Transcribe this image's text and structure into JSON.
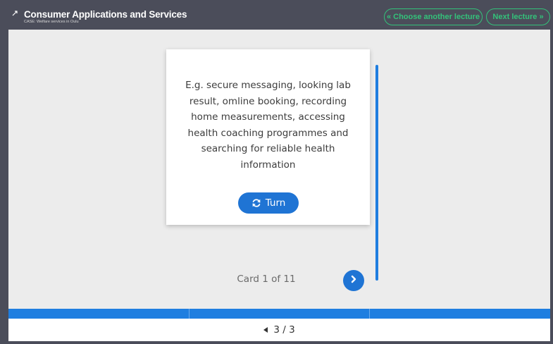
{
  "header": {
    "title": "Consumer Applications and Services",
    "subtitle": "CASE: Welfare services in Oulu",
    "choose_lecture_label": "« Choose another lecture",
    "next_lecture_label": "Next lecture »"
  },
  "card": {
    "text": "E.g. secure messaging, looking lab result, omline booking, recording home measurements, accessing health coaching programmes and searching for reliable health information",
    "turn_label": "Turn"
  },
  "navigation": {
    "card_counter": "Card 1 of 11",
    "page_indicator": "3 / 3"
  },
  "progress": {
    "fraction": 1.0
  },
  "colors": {
    "header_bg": "#4b4d5a",
    "accent_green": "#33c27a",
    "primary_blue": "#1f74d4",
    "content_bg": "#ececec"
  },
  "icons": [
    "collapse-icon",
    "refresh-icon",
    "chevron-right-icon",
    "triangle-left-icon"
  ]
}
